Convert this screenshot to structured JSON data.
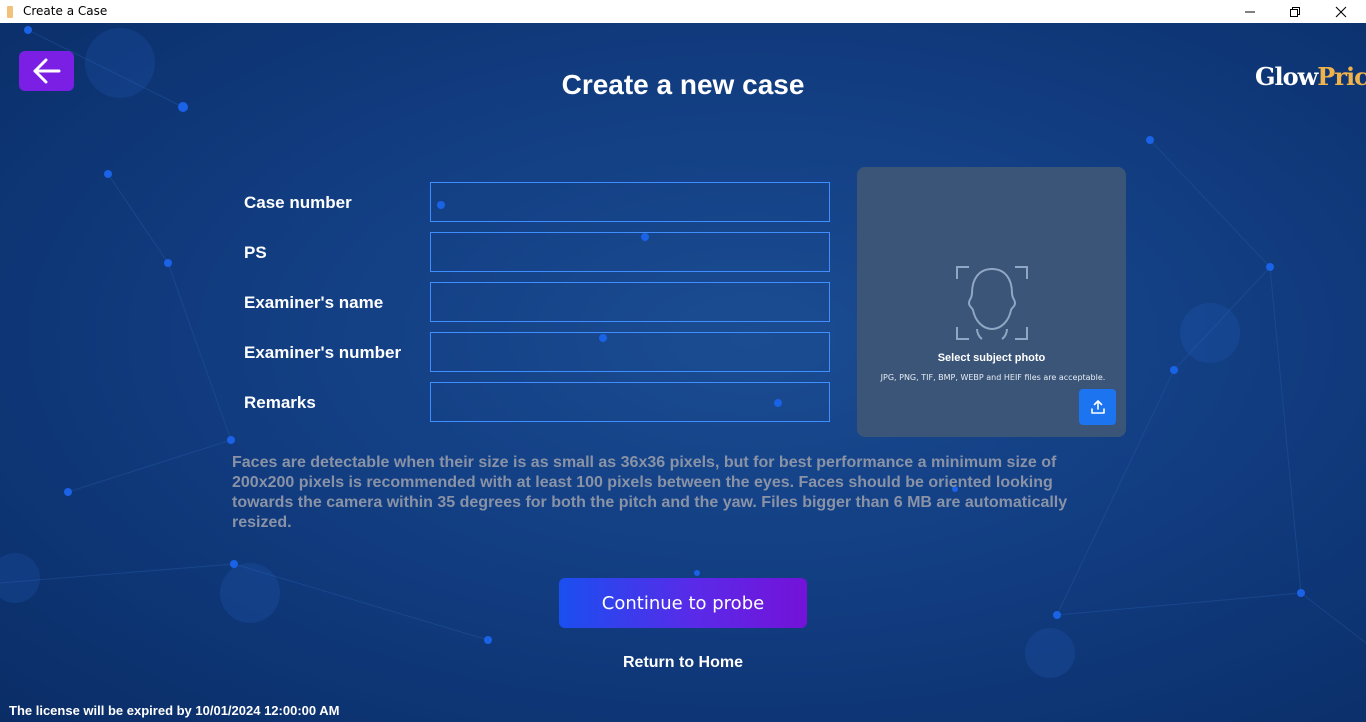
{
  "window": {
    "title": "Create a Case",
    "controls": [
      "minimize-icon",
      "restore-icon",
      "close-icon"
    ]
  },
  "header": {
    "title": "Create a new case",
    "logo": "GlowPrice",
    "back_icon": "arrow-left-icon"
  },
  "form": {
    "fields": [
      {
        "label": "Case number",
        "value": ""
      },
      {
        "label": "PS",
        "value": ""
      },
      {
        "label": "Examiner's name",
        "value": ""
      },
      {
        "label": "Examiner's number",
        "value": ""
      },
      {
        "label": "Remarks",
        "value": ""
      }
    ]
  },
  "photo": {
    "title": "Select subject photo",
    "hint": "JPG, PNG, TIF, BMP, WEBP and HEIF files are acceptable.",
    "icon": "face-scan-icon",
    "upload_icon": "upload-icon"
  },
  "info": "Faces are detectable when their size is as small as 36x36 pixels, but for best performance a minimum size of 200x200 pixels is recommended with at least 100 pixels between the eyes. Faces should be oriented looking towards the camera within 35 degrees for both the pitch and the yaw. Files bigger than 6 MB are automatically resized.",
  "actions": {
    "continue": "Continue to probe",
    "return": "Return to Home"
  },
  "license": "The license will be expired by 10/01/2024 12:00:00 AM",
  "colors": {
    "accent_purple": "#7a1fe3",
    "input_border": "#3f8dff",
    "upload_blue": "#1d74f0",
    "background": "#133f84"
  }
}
